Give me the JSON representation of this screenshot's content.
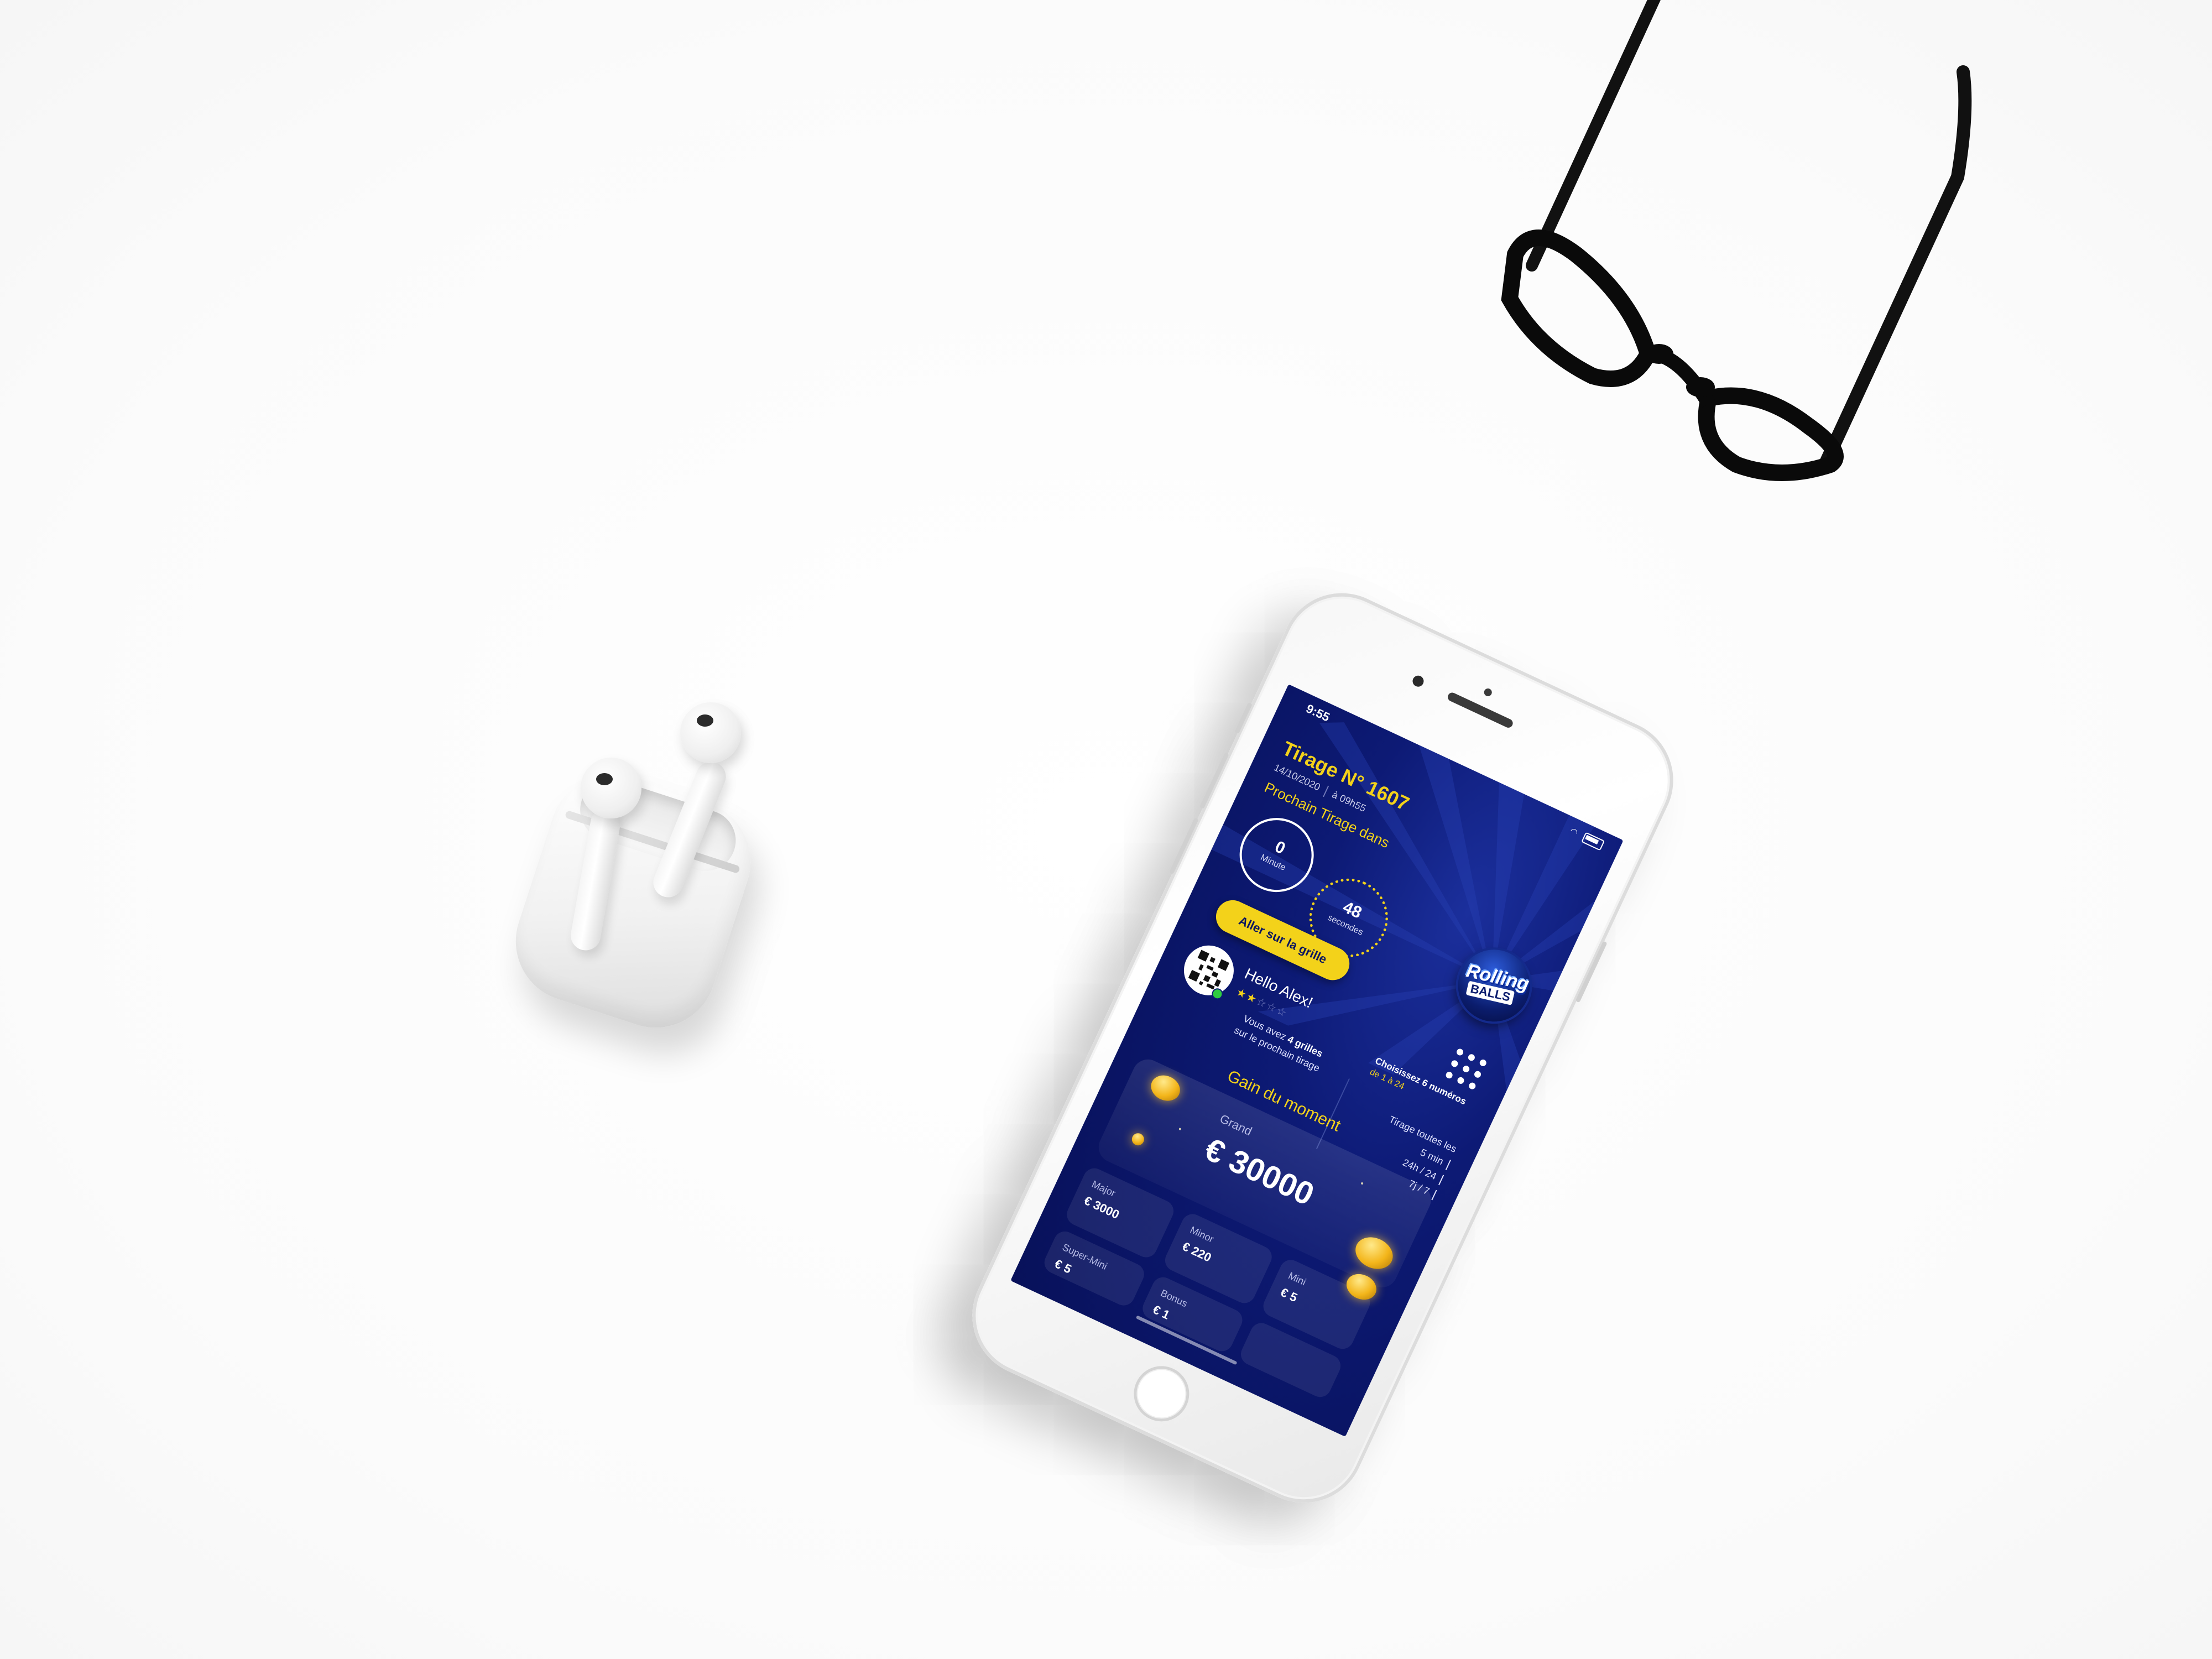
{
  "status_bar": {
    "time": "9:55"
  },
  "draw": {
    "title": "Tirage N° 1607",
    "date": "14/10/2020",
    "time": "à 09h55",
    "next_draw_label": "Prochain Tirage dans"
  },
  "countdown": {
    "minutes_value": "0",
    "minutes_unit": "Minute",
    "seconds_value": "48",
    "seconds_unit": "secondes"
  },
  "actions": {
    "go_to_grid_label": "Aller sur la grille"
  },
  "logo": {
    "line1": "Rolling",
    "line2": "BALLS"
  },
  "grid_info": {
    "choose_text": "Choisissez 6 numéros",
    "range_text": "de 1 à 24"
  },
  "user": {
    "greeting": "Hello Alex!",
    "rating_stars": 2,
    "rating_max": 5,
    "grids_line1_prefix": "Vous avez",
    "grids_count_text": "4 grilles",
    "grids_line2": "sur le prochain tirage"
  },
  "frequency": {
    "title": "Tirage toutes les",
    "line1": "5 min",
    "line2": "24h / 24",
    "line3": "7j / 7"
  },
  "gain": {
    "title": "Gain du moment",
    "jackpot_label": "Grand",
    "jackpot_value": "€ 30000",
    "prizes": [
      {
        "name": "Major",
        "amount": "€ 3000"
      },
      {
        "name": "Minor",
        "amount": "€ 220"
      },
      {
        "name": "Mini",
        "amount": "€ 5"
      },
      {
        "name": "Super-Mini",
        "amount": "€ 5"
      },
      {
        "name": "Bonus",
        "amount": "€ 1"
      }
    ]
  },
  "colors": {
    "background_navy": "#0d1a75",
    "accent_yellow": "#f3d21a",
    "text_white": "#ffffff"
  },
  "icons": {
    "grid_icon": "grid-dots-icon",
    "wifi_icon": "wifi-icon",
    "battery_icon": "battery-icon"
  }
}
